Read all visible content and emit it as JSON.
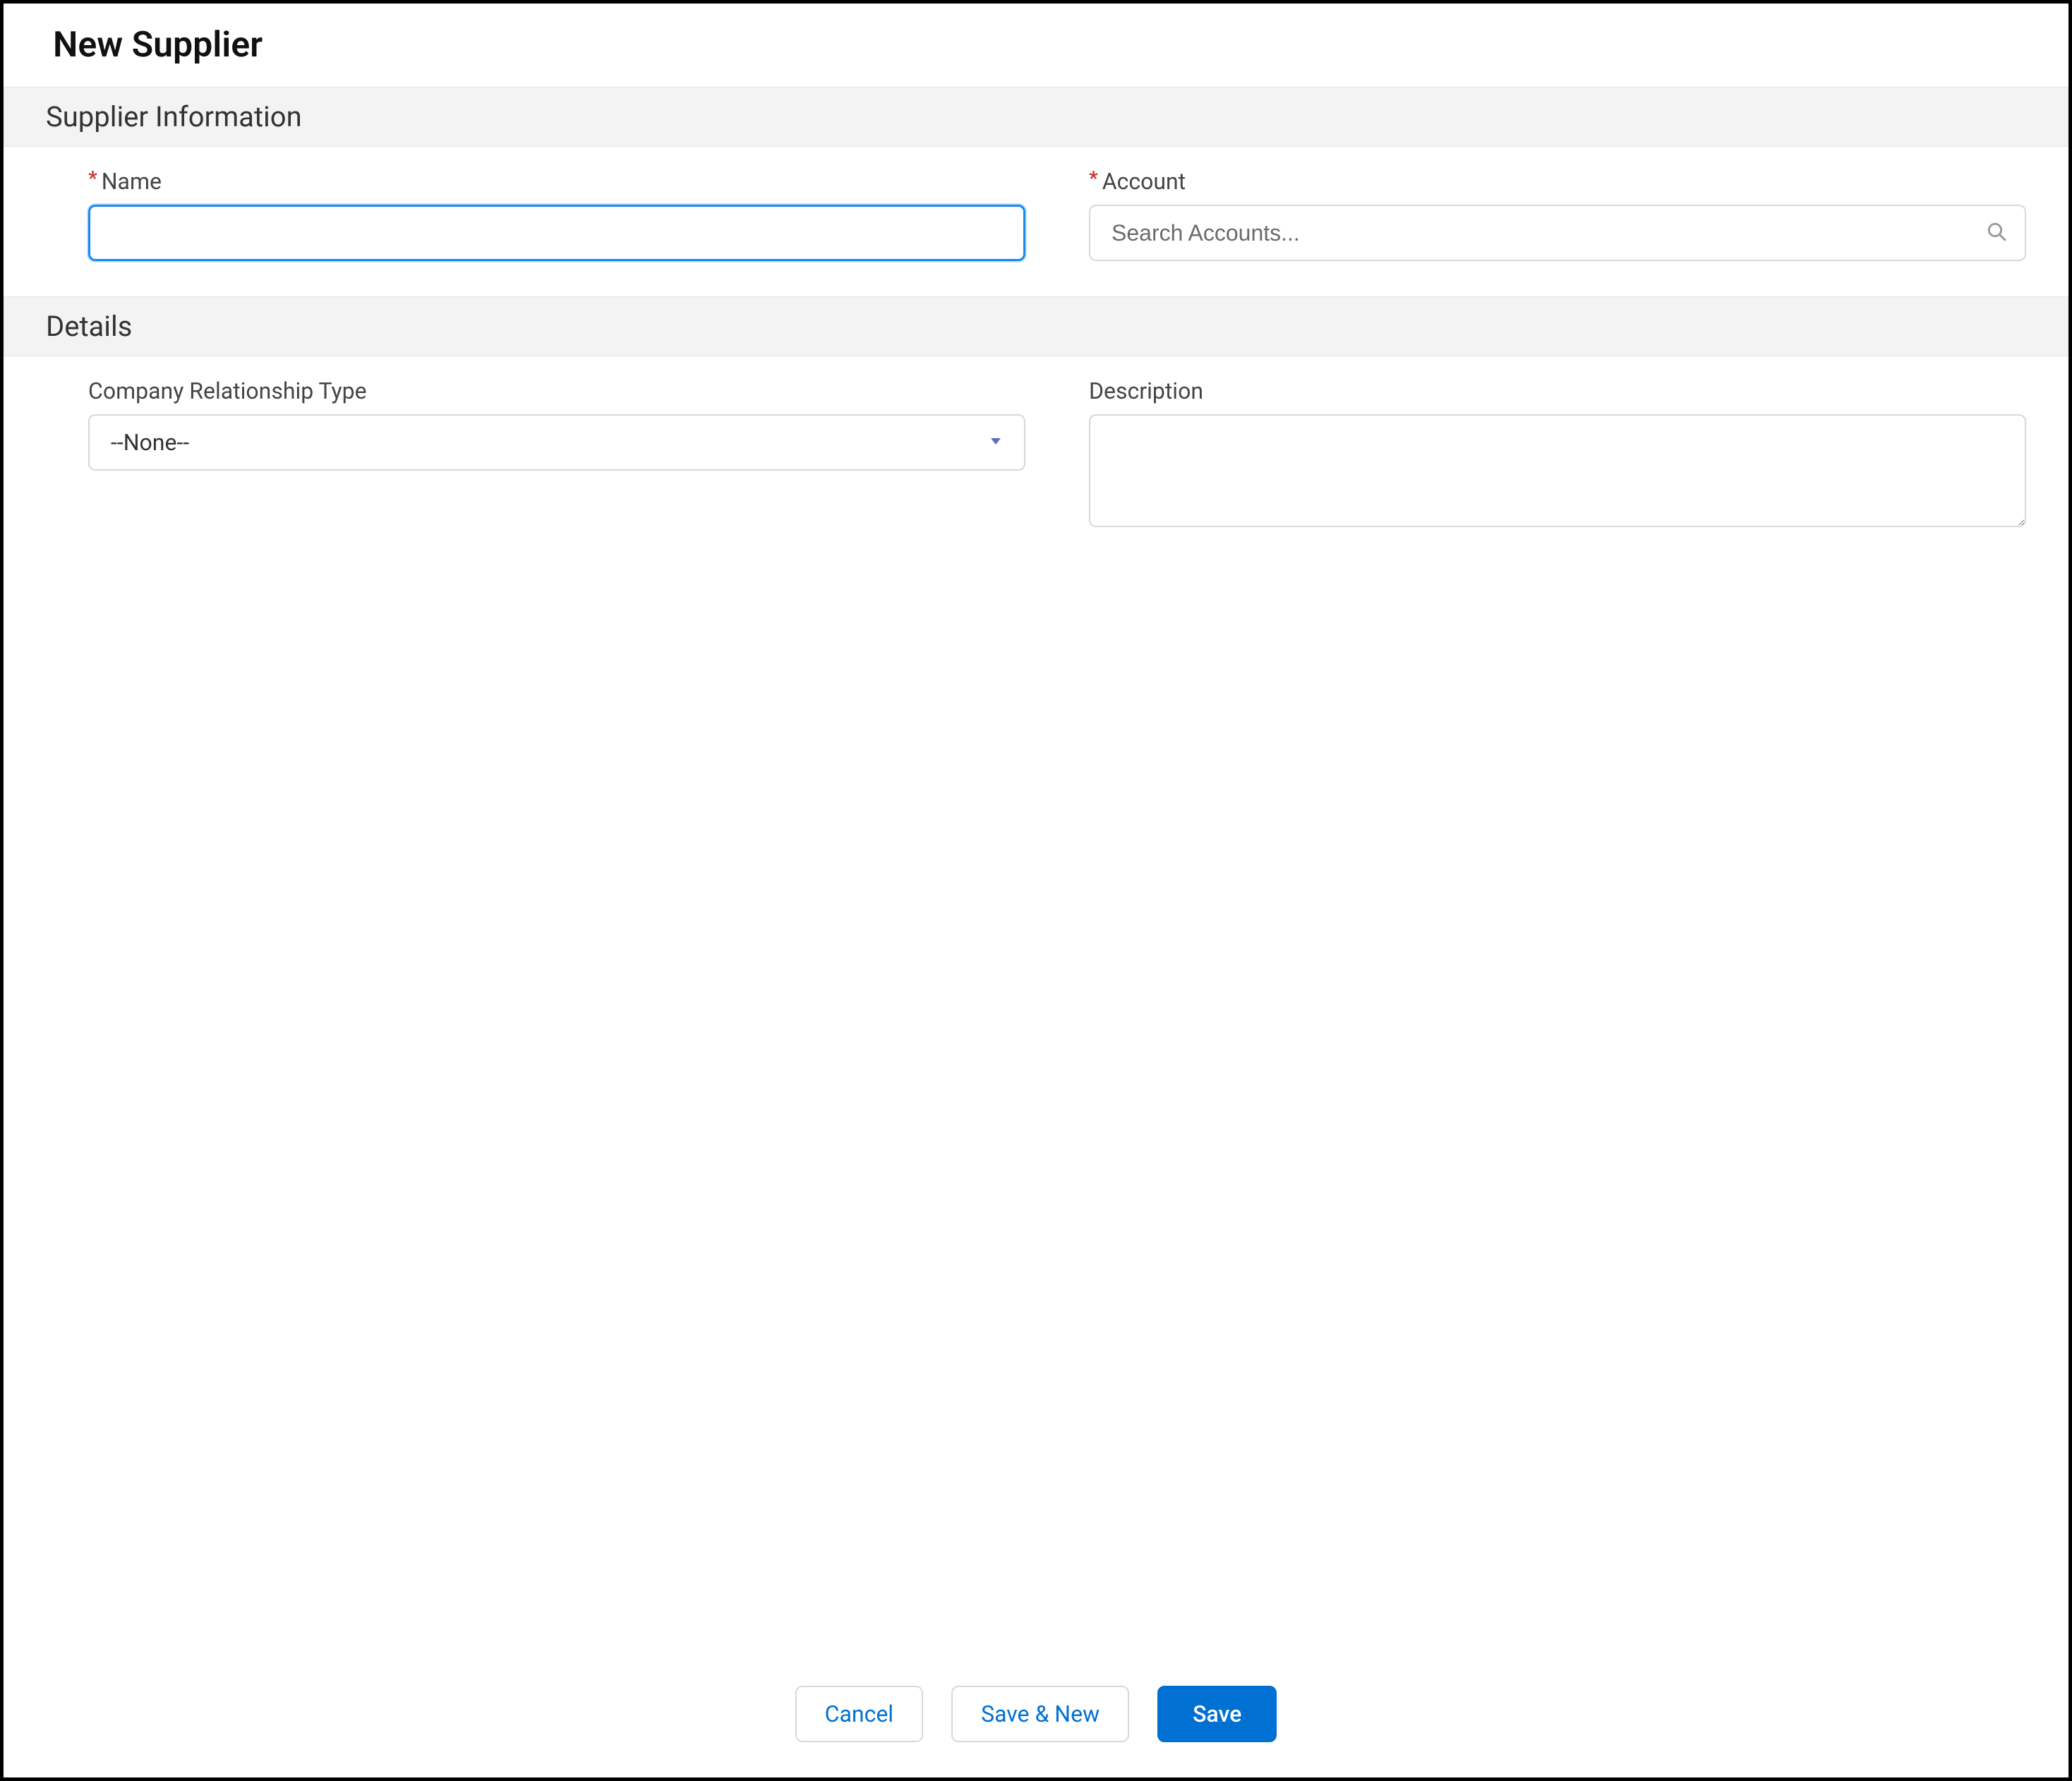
{
  "header": {
    "title": "New Supplier"
  },
  "sections": {
    "supplier_info": {
      "heading": "Supplier Information",
      "name": {
        "label": "Name",
        "required": true,
        "value": ""
      },
      "account": {
        "label": "Account",
        "required": true,
        "placeholder": "Search Accounts...",
        "value": ""
      }
    },
    "details": {
      "heading": "Details",
      "relationship_type": {
        "label": "Company Relationship Type",
        "selected": "--None--"
      },
      "description": {
        "label": "Description",
        "value": ""
      }
    }
  },
  "footer": {
    "cancel": "Cancel",
    "save_new": "Save & New",
    "save": "Save"
  },
  "required_marker": "*"
}
